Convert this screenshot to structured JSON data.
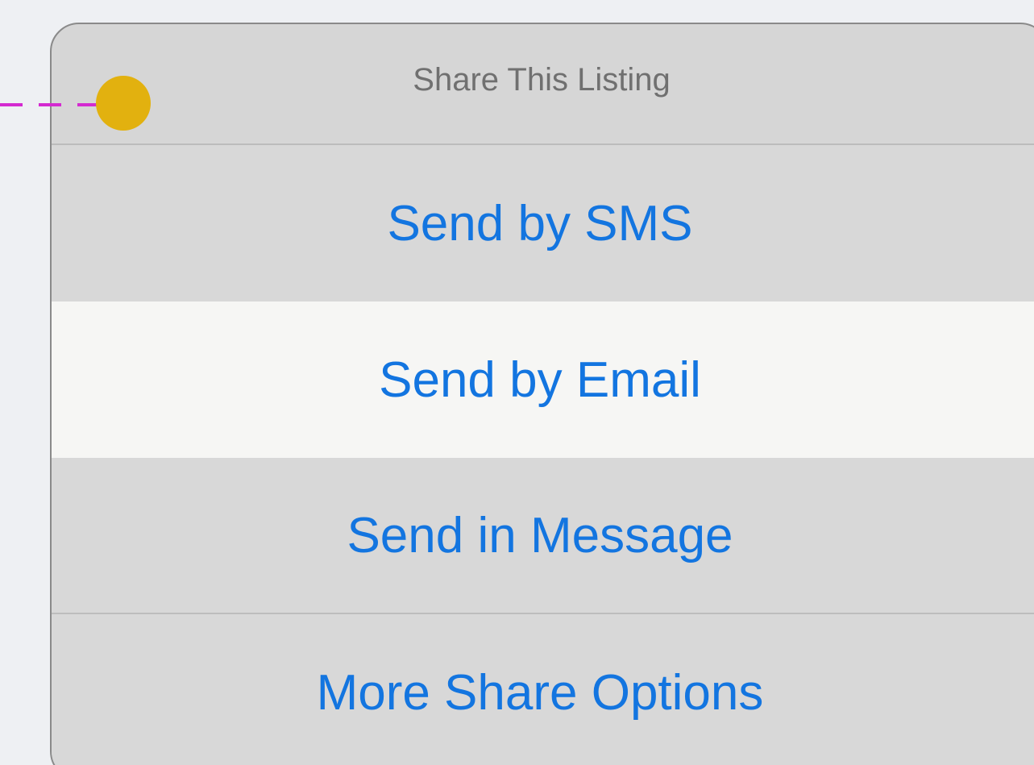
{
  "sheet": {
    "title": "Share This Listing",
    "options": [
      {
        "label": "Send by SMS"
      },
      {
        "label": "Send by Email"
      },
      {
        "label": "Send in Message"
      },
      {
        "label": "More Share Options"
      }
    ]
  },
  "colors": {
    "option_text": "#1375e0",
    "header_text": "#707070",
    "highlight": "#f6f6f4",
    "sheet_bg": "#d6d6d6",
    "marker": "#e2b10f",
    "connector": "#d42ad0"
  }
}
